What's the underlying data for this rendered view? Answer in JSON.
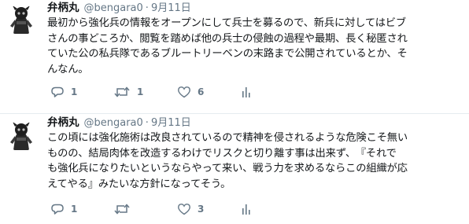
{
  "tweets": [
    {
      "author": {
        "name": "弁柄丸",
        "handle": "@bengara0"
      },
      "separator": "·",
      "date": "9月11日",
      "lines": [
        "最初から強化兵の情報をオープンにして兵士を募るので、新兵に対してはビブ",
        "さんの事どころか、閲覧を踏めば他の兵士の侵蝕の過程や最期、長く秘匿され",
        "ていた公の私兵隊であるブルートリーベンの末路まで公開されているとか、そ",
        "んなん。"
      ],
      "actions": {
        "replies": "1",
        "retweets": "1",
        "likes": "6"
      }
    },
    {
      "author": {
        "name": "弁柄丸",
        "handle": "@bengara0"
      },
      "separator": "·",
      "date": "9月11日",
      "lines": [
        "この頃には強化施術は改良されているので精神を侵されるような危険こそ無い",
        "ものの、結局肉体を改造するわけでリスクと切り離す事は出来ず、　『それで",
        "も強化兵になりたいというならやって来い、戦う力を求めるならこの組織が応",
        "えてやる』みたいな方針になってそう。"
      ],
      "actions": {
        "replies": "1",
        "retweets": "",
        "likes": "3"
      }
    }
  ],
  "icons": {
    "reply": "reply-icon",
    "retweet": "retweet-icon",
    "like": "heart-icon",
    "analytics": "analytics-icon"
  },
  "colors": {
    "text": "#14171a",
    "secondary": "#657786",
    "divider": "#e6ecf0"
  }
}
